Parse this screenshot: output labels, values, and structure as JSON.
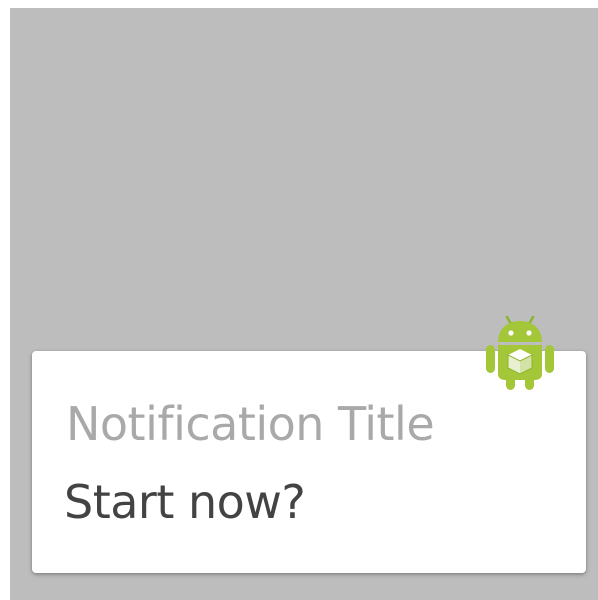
{
  "screen": {
    "background_color": "#bdbdbd"
  },
  "notification": {
    "title": "Notification Title",
    "text": "Start now?",
    "icon": "android-robot-icon",
    "accent_color": "#a4c639"
  }
}
